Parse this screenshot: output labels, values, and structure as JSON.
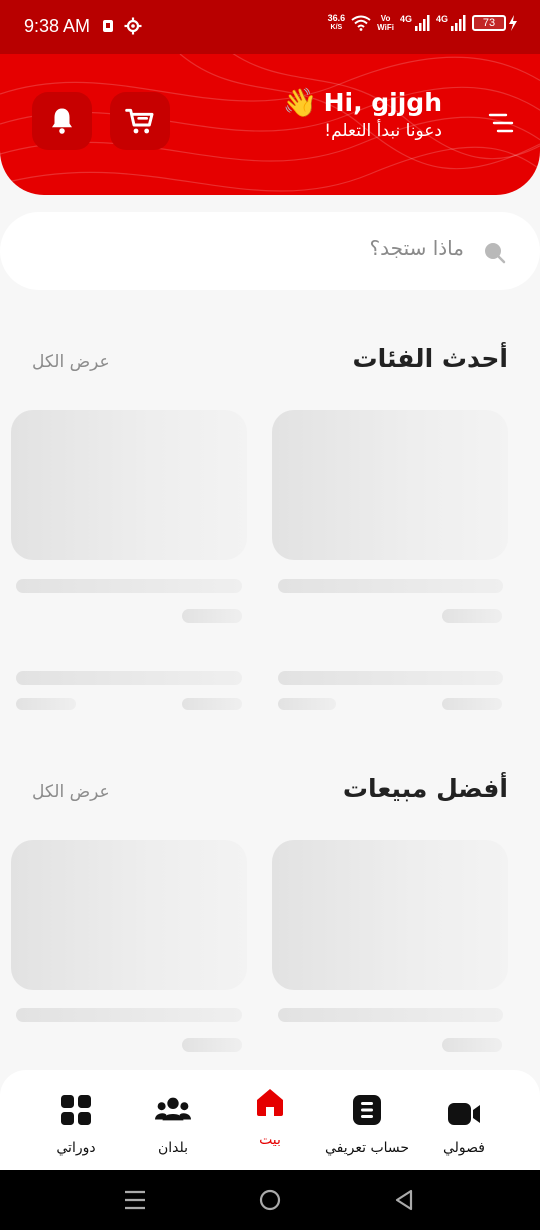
{
  "status_bar": {
    "time": "9:38 AM",
    "net_speed_value": "36.6",
    "net_speed_unit": "K/S",
    "vowifi_top": "Vo",
    "vowifi_bottom": "WiFi",
    "signal1_label": "4G",
    "signal2_label": "4G",
    "battery": "73"
  },
  "header": {
    "greeting": "Hi,  gjjgh",
    "subtitle": "دعونا نبدأ التعلم!",
    "wave_emoji": "👋"
  },
  "search": {
    "placeholder": "ماذا ستجد؟"
  },
  "sections": [
    {
      "title": "أحدث الفئات",
      "view_all": "عرض الكل"
    },
    {
      "title": "أفضل مبيعات",
      "view_all": "عرض الكل"
    }
  ],
  "bottom_nav": {
    "items": [
      {
        "label": "دوراتي",
        "icon": "grid-icon"
      },
      {
        "label": "بلدان",
        "icon": "users-icon"
      },
      {
        "label": "بيت",
        "icon": "home-icon",
        "active": true
      },
      {
        "label": "حساب تعريفي",
        "icon": "profile-doc-icon"
      },
      {
        "label": "فصولي",
        "icon": "video-icon"
      }
    ]
  },
  "colors": {
    "brand_red": "#e50000",
    "dark_red": "#b80000",
    "skeleton": "#e2e2e2"
  }
}
